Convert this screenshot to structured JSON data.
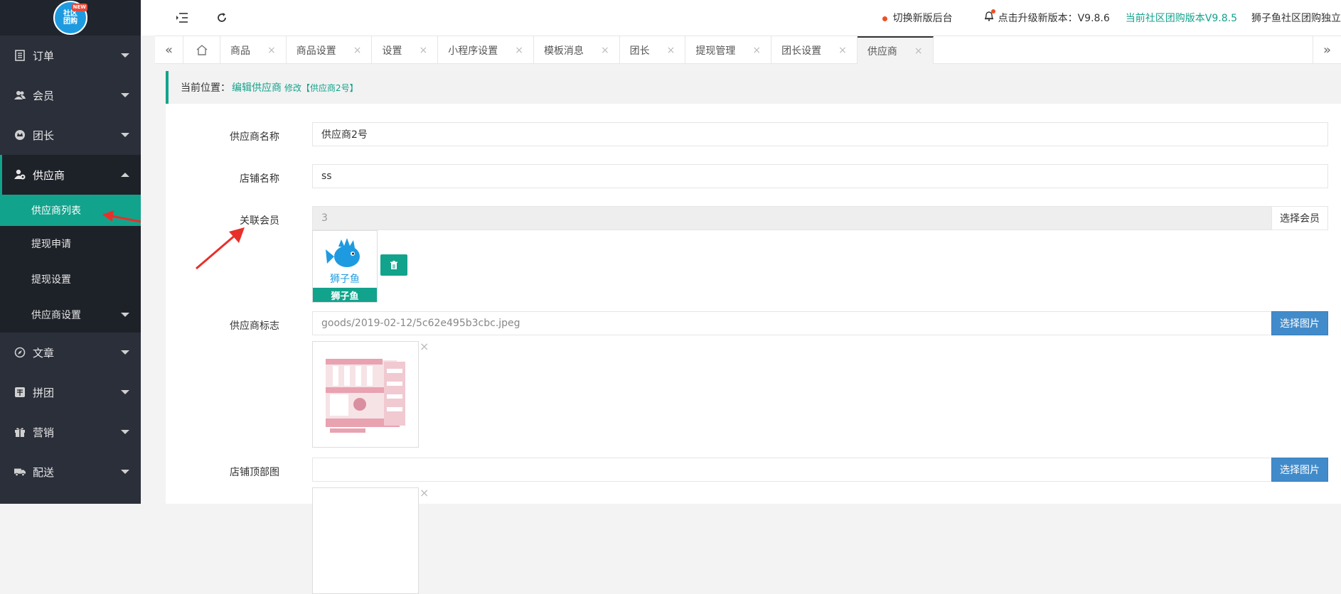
{
  "app": {
    "logo_text": "社区团购",
    "logo_badge": "NEW"
  },
  "sidebar": {
    "items": [
      {
        "label": "订单",
        "icon": "document-icon"
      },
      {
        "label": "会员",
        "icon": "users-icon"
      },
      {
        "label": "团长",
        "icon": "crown-icon"
      },
      {
        "label": "供应商",
        "icon": "supplier-icon",
        "open": true,
        "children": [
          {
            "label": "供应商列表",
            "active": true
          },
          {
            "label": "提现申请"
          },
          {
            "label": "提现设置"
          },
          {
            "label": "供应商设置",
            "has_children": true
          }
        ]
      },
      {
        "label": "文章",
        "icon": "compass-icon"
      },
      {
        "label": "拼团",
        "icon": "group-buy-icon"
      },
      {
        "label": "营销",
        "icon": "gift-icon"
      },
      {
        "label": "配送",
        "icon": "truck-icon"
      }
    ]
  },
  "topbar": {
    "switch_label": "切换新版后台",
    "upgrade_label": "点击升级新版本：V9.8.6",
    "current_version": "当前社区团购版本V9.8.5",
    "site_name": "狮子鱼社区团购独立"
  },
  "tabs": [
    {
      "label": "商品"
    },
    {
      "label": "商品设置"
    },
    {
      "label": "设置"
    },
    {
      "label": "小程序设置"
    },
    {
      "label": "模板消息"
    },
    {
      "label": "团长"
    },
    {
      "label": "提现管理"
    },
    {
      "label": "团长设置"
    },
    {
      "label": "供应商",
      "active": true
    }
  ],
  "breadcrumb": {
    "prefix": "当前位置：",
    "page": "编辑供应商",
    "action": "修改【供应商2号】"
  },
  "form": {
    "supplier_name": {
      "label": "供应商名称",
      "value": "供应商2号"
    },
    "shop_name": {
      "label": "店铺名称",
      "value": "ss"
    },
    "member": {
      "label": "关联会员",
      "value": "3",
      "button": "选择会员",
      "member_name": "狮子鱼",
      "avatar_text": "狮子鱼"
    },
    "logo": {
      "label": "供应商标志",
      "value": "goods/2019-02-12/5c62e495b3cbc.jpeg",
      "button": "选择图片"
    },
    "banner": {
      "label": "店铺顶部图",
      "value": "",
      "button": "选择图片"
    }
  },
  "colors": {
    "accent": "#12a38c",
    "sidebar_bg": "#2a2f3a",
    "annotation_arrow": "#e8302a",
    "button_blue": "#428bca"
  }
}
